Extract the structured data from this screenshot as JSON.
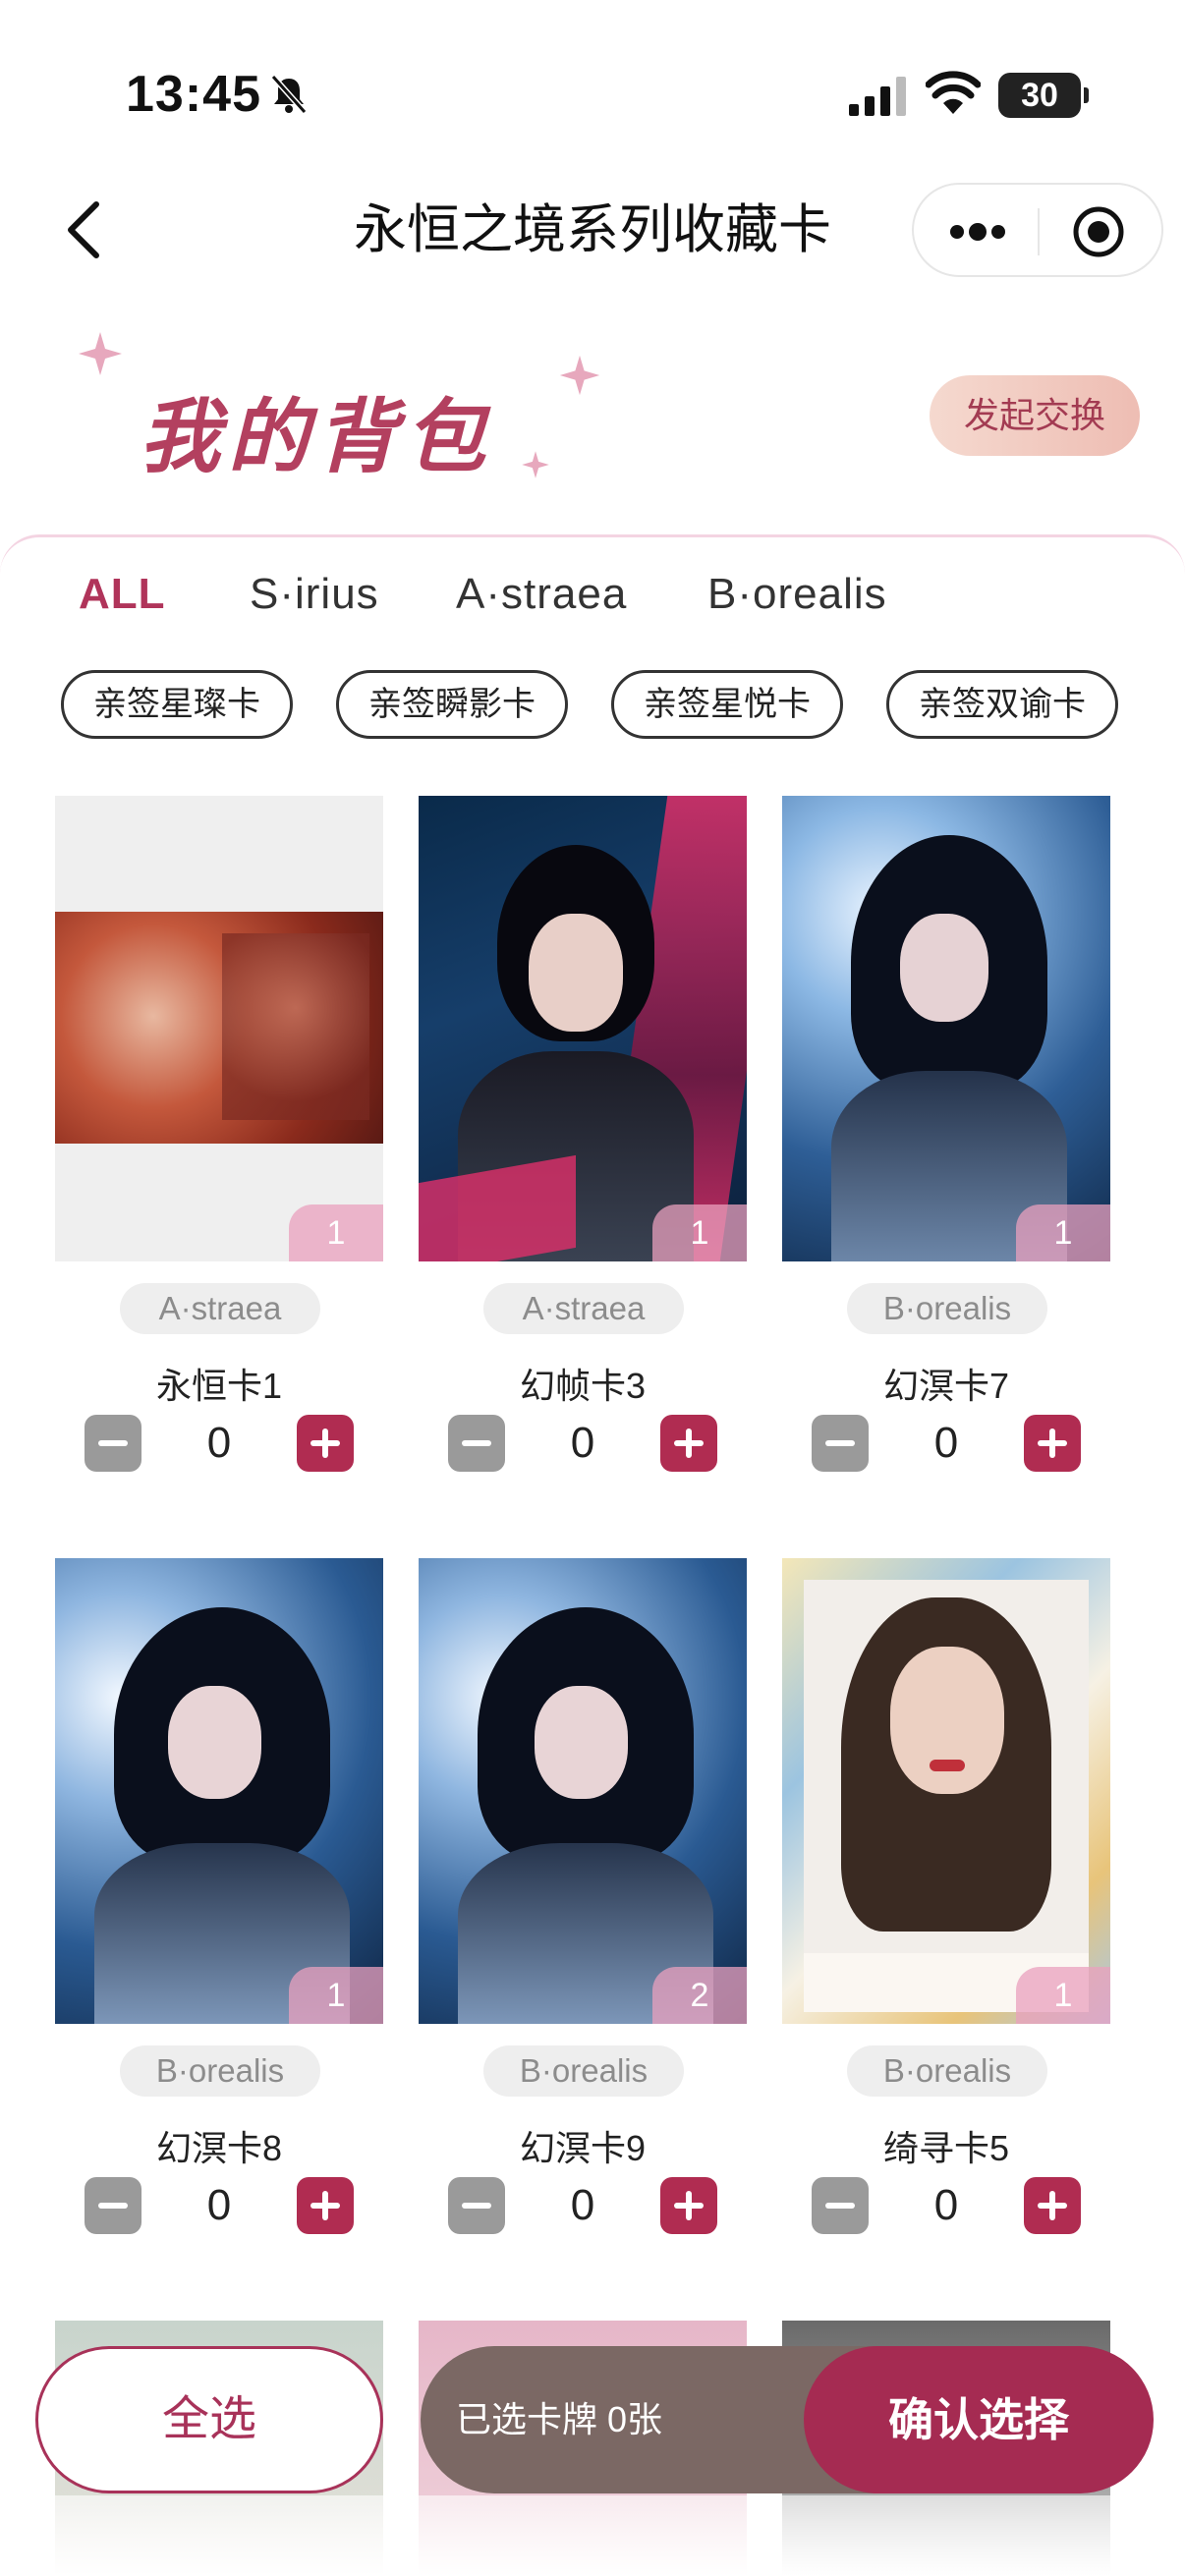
{
  "status_bar": {
    "time": "13:45",
    "battery": "30"
  },
  "nav": {
    "title": "永恒之境系列收藏卡"
  },
  "header": {
    "title": "我的背包",
    "exchange_label": "发起交换"
  },
  "tabs": [
    {
      "label": "ALL",
      "active": true
    },
    {
      "label": "S·irius",
      "active": false
    },
    {
      "label": "A·straea",
      "active": false
    },
    {
      "label": "B·orealis",
      "active": false
    }
  ],
  "chips": [
    "亲签星璨卡",
    "亲签瞬影卡",
    "亲签星悦卡",
    "亲签双谕卡"
  ],
  "cards": [
    {
      "name": "永恒卡1",
      "series": "A·straea",
      "qty": "1",
      "count": "0"
    },
    {
      "name": "幻帧卡3",
      "series": "A·straea",
      "qty": "1",
      "count": "0"
    },
    {
      "name": "幻溟卡7",
      "series": "B·orealis",
      "qty": "1",
      "count": "0"
    },
    {
      "name": "幻溟卡8",
      "series": "B·orealis",
      "qty": "1",
      "count": "0"
    },
    {
      "name": "幻溟卡9",
      "series": "B·orealis",
      "qty": "2",
      "count": "0"
    },
    {
      "name": "绮寻卡5",
      "series": "B·orealis",
      "qty": "1",
      "count": "0"
    }
  ],
  "bottom_bar": {
    "select_all_label": "全选",
    "selected_text": "已选卡牌 0张",
    "confirm_label": "确认选择"
  },
  "colors": {
    "accent": "#b02c51",
    "tab_active": "#b0345a",
    "selection_bar": "#7b6864"
  }
}
